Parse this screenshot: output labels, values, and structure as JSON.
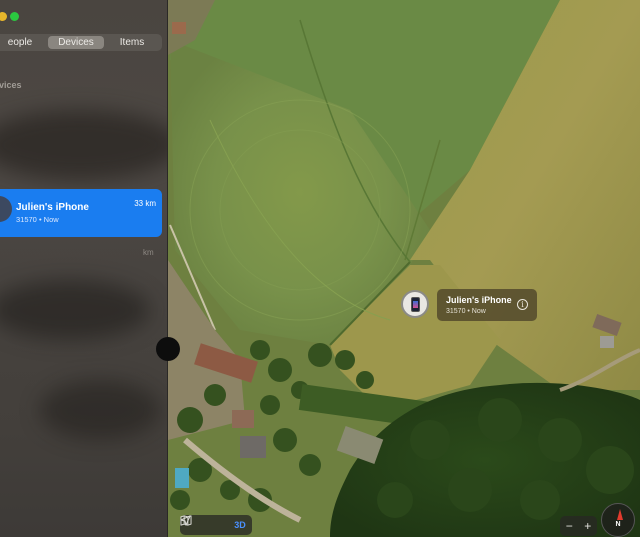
{
  "sidebar": {
    "tabs": [
      {
        "label": "eople",
        "active": false
      },
      {
        "label": "Devices",
        "active": true
      },
      {
        "label": "Items",
        "active": false
      }
    ],
    "section_header": "evices",
    "devices": [
      {
        "name": "Julien's iPhone",
        "subtitle": "31570 • Now",
        "distance": "33 km",
        "selected": true
      },
      {
        "distance": "km"
      }
    ]
  },
  "map": {
    "callout": {
      "name": "Julien's iPhone",
      "subtitle": "31570 • Now",
      "info_icon": "info-icon"
    },
    "mode_buttons": [
      {
        "icon": "location-arrow-icon"
      },
      {
        "icon": "map-icon"
      },
      {
        "label": "3D",
        "active": true
      }
    ],
    "zoom_out": "−",
    "zoom_in": "+",
    "compass_label": "N"
  },
  "colors": {
    "selection_blue": "#1a7df0",
    "callout_bg": "#544a2c",
    "field_green": "#6f7f3c",
    "forest": "#2d4a1c"
  }
}
